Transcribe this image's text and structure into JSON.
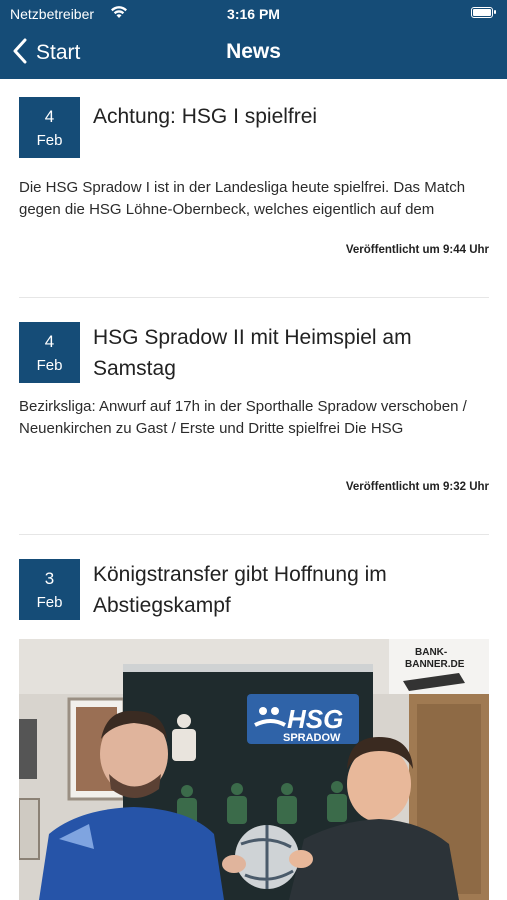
{
  "status_bar": {
    "carrier": "Netzbetreiber",
    "time": "3:16 PM",
    "wifi_icon": "wifi-icon",
    "battery_icon": "battery-icon"
  },
  "nav": {
    "back_label": "Start",
    "title": "News",
    "back_icon": "chevron-left-icon"
  },
  "colors": {
    "brand": "#154c77",
    "divider": "#e6e6e6"
  },
  "news": [
    {
      "day": "4",
      "month": "Feb",
      "title": "Achtung: HSG I spielfrei",
      "excerpt": "Die HSG Spradow I ist in der Landesliga heute spielfrei. Das Match gegen die HSG Löhne-Obernbeck, welches eigentlich auf dem",
      "published": "Veröffentlicht um 9:44 Uhr"
    },
    {
      "day": "4",
      "month": "Feb",
      "title": "HSG Spradow II mit Heimspiel am Samstag",
      "excerpt": "Bezirksliga: Anwurf auf 17h in der Sporthalle Spradow verschoben / Neuenkirchen zu Gast / Erste und Dritte spielfrei Die HSG",
      "published": "Veröffentlicht um 9:32 Uhr"
    },
    {
      "day": "3",
      "month": "Feb",
      "title": "Königstransfer gibt Hoffnung im Abstiegskampf",
      "image": {
        "banner_text": "HSG",
        "banner_subtext": "SPRADOW",
        "sponsor_text_1": "BANK-",
        "sponsor_text_2": "BANNER.DE"
      }
    }
  ]
}
